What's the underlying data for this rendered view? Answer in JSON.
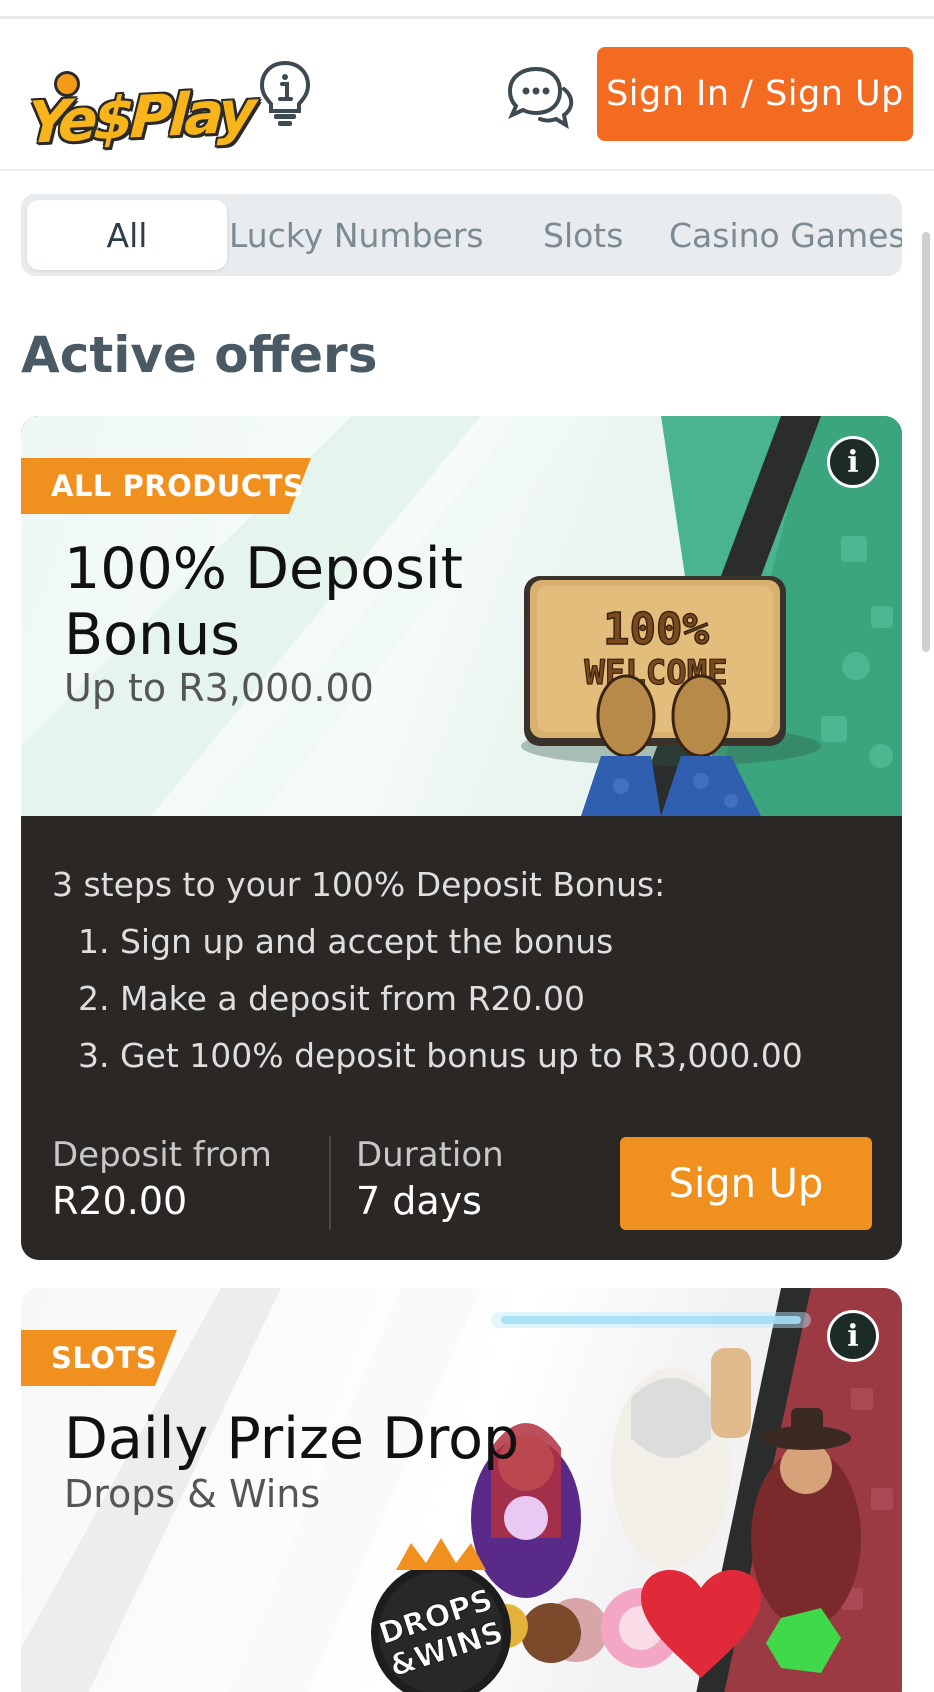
{
  "header": {
    "logo_text": "Ye$Play",
    "signin_label": "Sign In / Sign Up"
  },
  "tabs": [
    {
      "label": "All",
      "active": true
    },
    {
      "label": "Lucky Numbers",
      "active": false
    },
    {
      "label": "Slots",
      "active": false
    },
    {
      "label": "Casino Games",
      "active": false
    }
  ],
  "section_title": "Active offers",
  "offers": [
    {
      "tag": "ALL PRODUCTS",
      "title_line1": "100% Deposit",
      "title_line2": "Bonus",
      "subtitle": "Up to R3,000.00",
      "image_text_line1": "100%",
      "image_text_line2": "WELCOME",
      "steps_heading": "3 steps to your 100% Deposit Bonus:",
      "steps": [
        "1. Sign up and accept the bonus",
        "2. Make a deposit from R20.00",
        "3. Get 100% deposit bonus up to R3,000.00"
      ],
      "deposit_label": "Deposit from",
      "deposit_value": "R20.00",
      "duration_label": "Duration",
      "duration_value": "7 days",
      "cta_label": "Sign Up"
    },
    {
      "tag": "SLOTS",
      "title": "Daily Prize Drop",
      "subtitle": "Drops & Wins",
      "image_text_line1": "DROPS",
      "image_text_line2": "&WINS"
    }
  ],
  "colors": {
    "brand_orange": "#f26b21",
    "tag_orange": "#f0911f",
    "card_dark": "#2a2724",
    "teal_accent": "#43b58a"
  },
  "icons": [
    "lightbulb-info-icon",
    "chat-bubbles-icon",
    "info-icon"
  ]
}
